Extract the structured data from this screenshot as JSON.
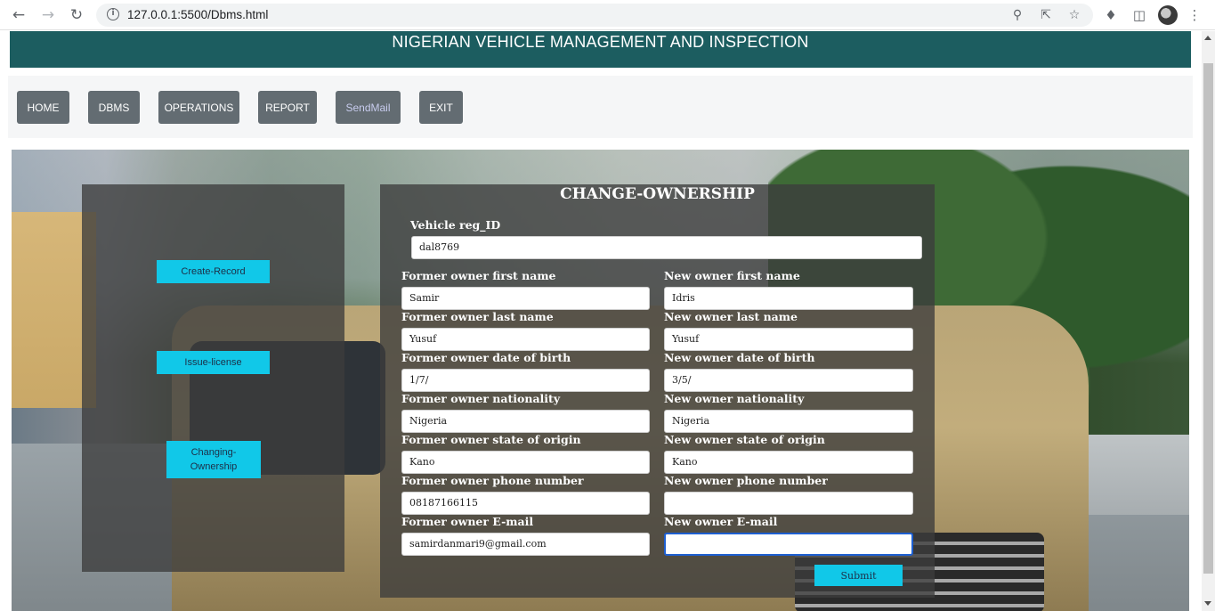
{
  "browser": {
    "url": "127.0.0.1:5500/Dbms.html"
  },
  "header": {
    "title": "NIGERIAN VEHICLE MANAGEMENT AND INSPECTION"
  },
  "menu": {
    "items": [
      {
        "label": "HOME"
      },
      {
        "label": "DBMS"
      },
      {
        "label": "OPERATIONS"
      },
      {
        "label": "REPORT"
      },
      {
        "label": "SendMail"
      },
      {
        "label": "EXIT"
      }
    ]
  },
  "side_panel": {
    "create_record": "Create-Record",
    "issue_license": "Issue-license",
    "changing_ownership": "Changing-\nOwnership"
  },
  "form": {
    "title": "CHANGE-OWNERSHIP",
    "vehicle_reg_label": "Vehicle reg_ID",
    "vehicle_reg_value": "dal8769",
    "former": {
      "first_name_label": "Former owner first name",
      "first_name": "Samir",
      "last_name_label": "Former owner last name",
      "last_name": "Yusuf",
      "dob_label": "Former owner date of birth",
      "dob": "1/7/",
      "nationality_label": "Former owner nationality",
      "nationality": "Nigeria",
      "state_label": "Former owner state of origin",
      "state": "Kano",
      "phone_label": "Former owner phone number",
      "phone": "08187166115",
      "email_label": "Former owner E-mail",
      "email": "samirdanmari9@gmail.com"
    },
    "new": {
      "first_name_label": "New owner first name",
      "first_name": "Idris",
      "last_name_label": "New owner last name",
      "last_name": "Yusuf",
      "dob_label": "New owner date of birth",
      "dob": "3/5/",
      "nationality_label": "New owner nationality",
      "nationality": "Nigeria",
      "state_label": "New owner state of origin",
      "state": "Kano",
      "phone_label": "New owner phone number",
      "phone": "",
      "email_label": "New owner E-mail",
      "email": ""
    },
    "submit_label": "Submit"
  },
  "colors": {
    "header_bg": "#1c5d60",
    "menu_button": "#636c72",
    "accent_button": "#11c8e8"
  }
}
